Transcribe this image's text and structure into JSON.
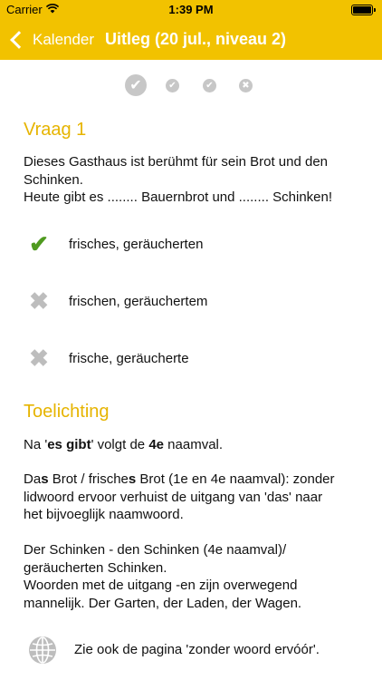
{
  "status": {
    "carrier": "Carrier",
    "time": "1:39 PM"
  },
  "nav": {
    "back_label": "Kalender",
    "title": "Uitleg (20 jul., niveau 2)"
  },
  "progress": {
    "icons": [
      "check-done",
      "check",
      "check",
      "cross"
    ]
  },
  "question": {
    "heading": "Vraag 1",
    "line1": "Dieses Gasthaus ist berühmt für sein Brot und den",
    "line2": "Schinken.",
    "line3": "Heute gibt es ........ Bauernbrot und ........ Schinken!"
  },
  "answers": [
    {
      "icon": "✔",
      "text": "frisches, geräucherten"
    },
    {
      "icon": "✖",
      "text": "frischen, geräuchertem"
    },
    {
      "icon": "✖",
      "text": "frische, geräucherte"
    }
  ],
  "explanation": {
    "heading": "Toelichting",
    "p1_a": "Na '",
    "p1_b": "es gibt",
    "p1_c": "' volgt de ",
    "p1_d": "4e",
    "p1_e": " naamval.",
    "p2_a": "Da",
    "p2_b": "s",
    "p2_c": " Brot / frische",
    "p2_d": "s",
    "p2_e": " Brot (1e en 4e naamval): zonder",
    "p2_line2": "lidwoord ervoor verhuist de uitgang van 'das' naar",
    "p2_line3": "het bijvoeglijk naamwoord.",
    "p3_line1": "Der Schinken - den Schinken (4e naamval)/",
    "p3_line2": "geräucherten Schinken.",
    "p3_line3": "Woorden met de uitgang -en zijn overwegend",
    "p3_line4": "mannelijk. Der Garten, der Laden, der Wagen.",
    "link": "Zie ook de pagina 'zonder woord ervóór'."
  },
  "colors": {
    "brand": "#f2c200",
    "heading": "#e6b400",
    "correct": "#4f9a1f",
    "wrong": "#bdbdbd"
  }
}
